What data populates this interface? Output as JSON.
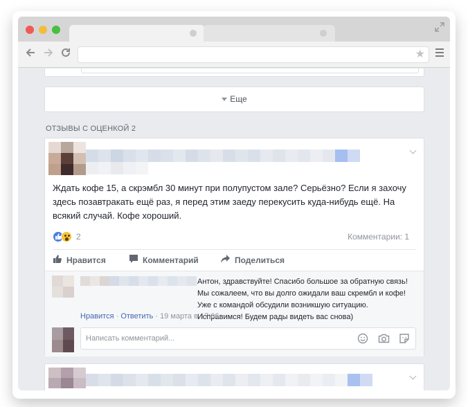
{
  "colors": {
    "page_bg": "#e9ebee",
    "accent_link": "#4267b2",
    "secondary_text": "#90949c"
  },
  "browser": {
    "icons": [
      "back-arrow-icon",
      "forward-arrow-icon",
      "reload-icon",
      "star-icon",
      "menu-icon",
      "expand-icon"
    ]
  },
  "more_button": {
    "label": "Еще"
  },
  "section": {
    "title": "ОТЗЫВЫ С ОЦЕНКОЙ 2"
  },
  "review": {
    "text": "Ждать кофе 15, а скрэмбл 30 минут при полупустом зале? Серьёзно? Если я захочу здесь позавтракать ещё раз, я перед этим заеду перекусить куда-нибудь ещё. На всякий случай. Кофе хороший.",
    "reaction_count": "2",
    "comments_count": "Комментарии: 1",
    "actions": {
      "like": "Нравится",
      "comment": "Комментарий",
      "share": "Поделиться"
    }
  },
  "reply": {
    "text": "Антон, здравствуйте! Спасибо большое за обратную связь! Мы сожалеем, что вы долго ожидали ваш скрембл и кофе! Уже с командой обсудили возникшую ситуацию. Исправимся! Будем рады видеть вас снова)",
    "like": "Нравится",
    "sep1": " · ",
    "answer": "Ответить",
    "sep2": " · ",
    "time": "19 марта в 17:06"
  },
  "comment_input": {
    "placeholder": "Написать комментарий..."
  }
}
